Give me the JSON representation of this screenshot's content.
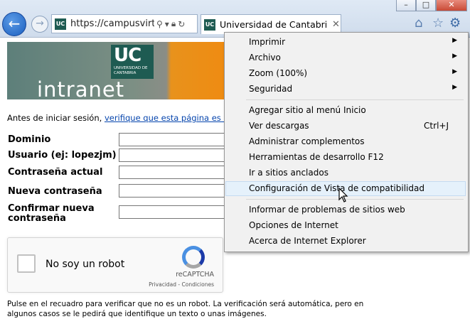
{
  "window": {
    "minimize": "–",
    "maximize": "□",
    "close": "✕"
  },
  "toolbar": {
    "back_icon": "arrow-left-icon",
    "forward_icon": "arrow-right-icon",
    "address_url": "https://campusvirt...",
    "favicon_text": "UC",
    "tab_title": "Universidad de Cantabria - ...",
    "home_icon": "⌂",
    "favorites_icon": "☆",
    "tools_icon": "⚙"
  },
  "banner": {
    "logo": "UC",
    "logo_sub": "UNIVERSIDAD DE CANTABRIA",
    "title": "intranet"
  },
  "intro": {
    "text": "Antes de iniciar sesión, ",
    "link": "verifique que esta página es la"
  },
  "form": {
    "domain_label": "Dominio",
    "user_label": "Usuario  (ej: lopezjm)",
    "current_pw_label": "Contraseña actual",
    "new_pw_label": "Nueva contraseña",
    "confirm_pw_label_line1": "Confirmar nueva",
    "confirm_pw_label_line2": "contraseña"
  },
  "recaptcha": {
    "label": "No soy un robot",
    "brand": "reCAPTCHA",
    "links": "Privacidad - Condiciones"
  },
  "note": "Pulse en el recuadro para verificar que no es un robot. La verificación será automática, pero en algunos casos se le pedirá que identifique un texto o unas imágenes.",
  "menu": {
    "items": [
      {
        "label": "Imprimir",
        "shortcut": "",
        "submenu": true
      },
      {
        "label": "Archivo",
        "shortcut": "",
        "submenu": true
      },
      {
        "label": "Zoom (100%)",
        "shortcut": "",
        "submenu": true
      },
      {
        "label": "Seguridad",
        "shortcut": "",
        "submenu": true
      },
      {
        "label": "Agregar sitio al menú Inicio",
        "shortcut": ""
      },
      {
        "label": "Ver descargas",
        "shortcut": "Ctrl+J"
      },
      {
        "label": "Administrar complementos",
        "shortcut": ""
      },
      {
        "label": "Herramientas de desarrollo F12",
        "shortcut": ""
      },
      {
        "label": "Ir a sitios anclados",
        "shortcut": ""
      },
      {
        "label": "Configuración de Vista de compatibilidad",
        "shortcut": "",
        "highlighted": true
      },
      {
        "label": "Informar de problemas de sitios web",
        "shortcut": ""
      },
      {
        "label": "Opciones de Internet",
        "shortcut": ""
      },
      {
        "label": "Acerca de Internet Explorer",
        "shortcut": ""
      }
    ]
  },
  "colors": {
    "accent": "#1a5fbf",
    "uc_green": "#1e5b52",
    "banner_orange": "#f08a10",
    "menu_highlight": "#e5f1fb"
  }
}
